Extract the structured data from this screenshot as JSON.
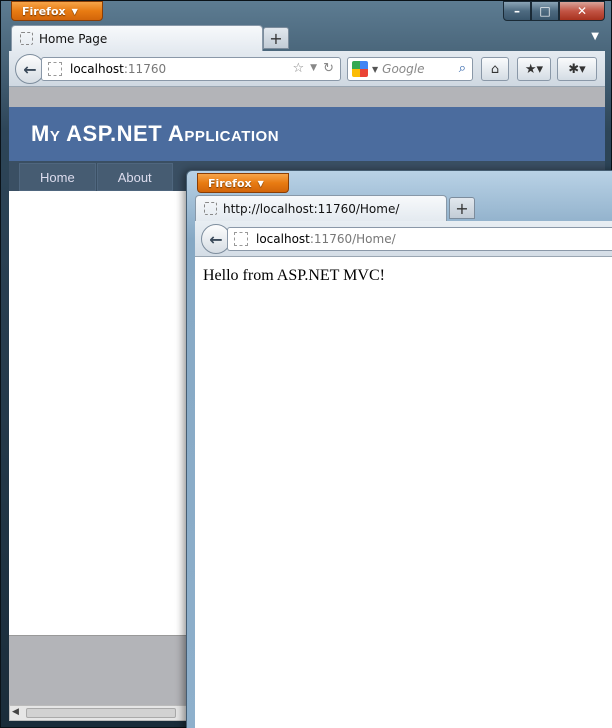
{
  "back_window": {
    "firefox_button": "Firefox",
    "controls": {
      "minimize": "–",
      "maximize": "□",
      "close": "✕"
    },
    "tab": {
      "title": "Home Page"
    },
    "new_tab": "+",
    "url": {
      "host": "localhost",
      "rest": ":11760"
    },
    "search": {
      "placeholder": "Google"
    },
    "site": {
      "title": "My ASP.NET Application",
      "menu": [
        "Home",
        "About"
      ]
    }
  },
  "front_window": {
    "firefox_button": "Firefox",
    "tab": {
      "title": "http://localhost:11760/Home/"
    },
    "new_tab": "+",
    "url": {
      "host": "localhost",
      "rest": ":11760/Home/"
    },
    "content": {
      "text": "Hello from ASP.NET MVC!"
    }
  },
  "icons": {
    "back": "arrow-left-icon",
    "bookmark_star": "star-icon",
    "reload": "reload-icon",
    "home": "home-icon",
    "search": "magnifier-icon"
  }
}
